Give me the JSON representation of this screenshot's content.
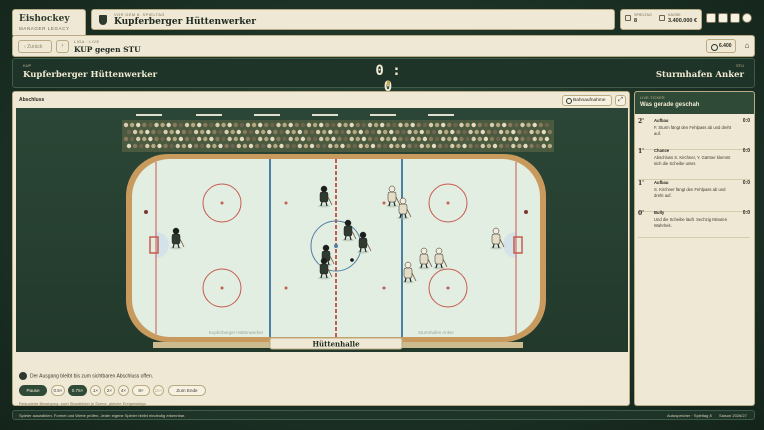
{
  "brand": {
    "title": "Eishockey",
    "subtitle": "MANAGER LEGACY"
  },
  "club": {
    "kicker": "VOR DEM 8. SPIELTAG",
    "name": "Kupferberger Hüttenwerker"
  },
  "stats": [
    {
      "label": "SPIELTAG",
      "value": "8"
    },
    {
      "label": "KASSE",
      "value": "3.400.000 €"
    }
  ],
  "toolbar_icons": [
    "squad-icon",
    "training-icon",
    "table-icon",
    "settings-icon"
  ],
  "nav": {
    "back_label": "Zurück",
    "forward_label": "›",
    "kicker": "LIGA · LIVE",
    "title": "KUP gegen STU",
    "coins": "6.400",
    "home_icon": "⌂"
  },
  "match": {
    "home_abbr": "KUP",
    "home_name": "Kupferberger Hüttenwerker",
    "away_abbr": "STU",
    "away_name": "Sturmhafen Anker",
    "score": "0 : 0"
  },
  "panel": {
    "heading": "Abschluss",
    "birdseye_label": "Bahnaufnahme",
    "fullscreen_icon": "⤢",
    "arena_name": "Hüttenhalle",
    "home_board_label": "Kupferberger Hüttenwerker",
    "away_board_label": "Sturmhafen Anker",
    "message": "Der Ausgang bleibt bis zum sichtbaren Abschluss offen.",
    "note": "Reduzierte Bewegung: zwei Standbilder je Szene, gleiche Ereignisfolge."
  },
  "controls": [
    {
      "label": "Pause",
      "active": true,
      "dim": false
    },
    {
      "label": "0.5×",
      "active": false,
      "dim": false
    },
    {
      "label": "0.75×",
      "active": true,
      "dim": false
    },
    {
      "label": "1×",
      "active": false,
      "dim": false
    },
    {
      "label": "2×",
      "active": false,
      "dim": false
    },
    {
      "label": "4×",
      "active": false,
      "dim": false
    },
    {
      "label": "8×",
      "active": false,
      "dim": false
    },
    {
      "label": "16×",
      "active": false,
      "dim": true
    },
    {
      "label": "Zum Ende",
      "active": false,
      "dim": false
    }
  ],
  "ticker": {
    "kicker": "LIVE-TICKER",
    "title": "Was gerade geschah",
    "events": [
      {
        "minute": "2'",
        "type": "Aufbau",
        "score": "0:0",
        "text": "F. Sturm fängt den Fehlpass ab und dreht auf."
      },
      {
        "minute": "1'",
        "type": "Chance",
        "score": "0:0",
        "text": "Abschluss S. Kirchner, Y. Gärtner klemmt sich die Scheibe unter."
      },
      {
        "minute": "1'",
        "type": "Aufbau",
        "score": "0:0",
        "text": "S. Kirchner fängt den Fehlpass ab und dreht auf."
      },
      {
        "minute": "0'",
        "type": "Bully",
        "score": "0:0",
        "text": "Und die Scheibe läuft. Sechzig Minuten Wahrheit."
      }
    ]
  },
  "footer": {
    "hint": "Spieler auswählen, Formel und Werte prüfen, Jeder eigene Spieler bleibt eindeutig erkennbar.",
    "autosave": "Autospeicher · Spieltag 8",
    "season": "Saison 2026/27"
  },
  "colors": {
    "dark_green": "#1f3428",
    "paper": "#efe8d4",
    "ice": "#e3eee3",
    "home_jersey": "#2f3a30",
    "away_jersey": "#e5dcc6",
    "board": "#c99a5d"
  }
}
